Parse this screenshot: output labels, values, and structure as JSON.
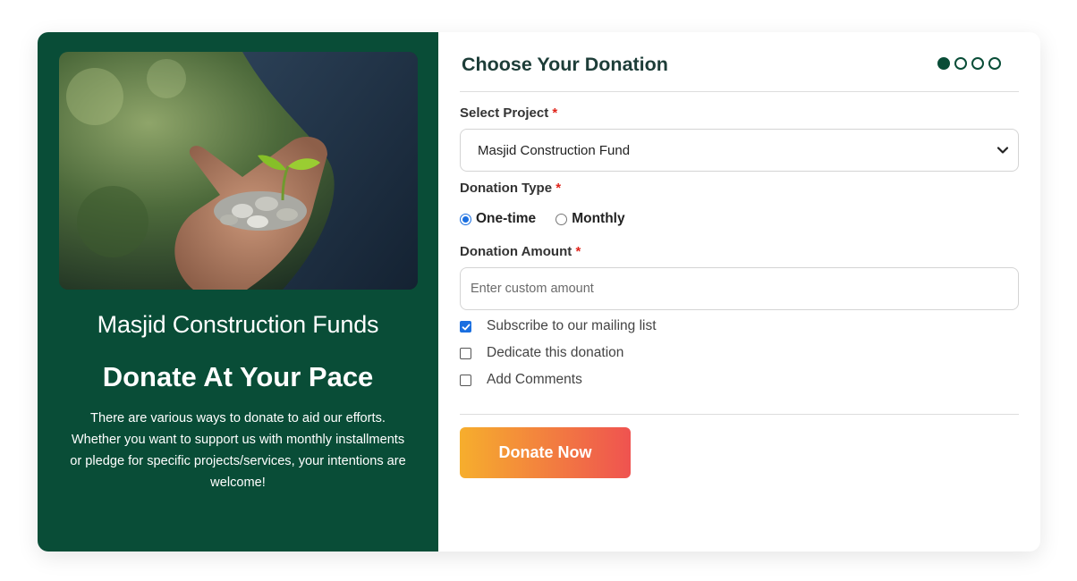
{
  "left_panel": {
    "title": "Masjid Construction Funds",
    "heading": "Donate At Your Pace",
    "description": "There are various ways to donate to aid our efforts. Whether you want to support us with monthly installments or pledge for specific projects/services, your intentions are welcome!"
  },
  "form": {
    "title": "Choose Your Donation",
    "steps": {
      "current": 1,
      "total": 4
    },
    "required_marker": "*",
    "project": {
      "label": "Select Project",
      "selected": "Masjid Construction Fund"
    },
    "donation_type": {
      "label": "Donation Type",
      "options": [
        {
          "label": "One-time",
          "selected": true
        },
        {
          "label": "Monthly",
          "selected": false
        }
      ]
    },
    "amount": {
      "label": "Donation Amount",
      "placeholder": "Enter custom amount",
      "value": ""
    },
    "checkboxes": [
      {
        "label": "Subscribe to our mailing list",
        "checked": true
      },
      {
        "label": "Dedicate this donation",
        "checked": false
      },
      {
        "label": "Add Comments",
        "checked": false
      }
    ],
    "submit_label": "Donate Now"
  },
  "colors": {
    "panel_green": "#094d37",
    "button_gradient_start": "#f6ae2d",
    "button_gradient_end": "#ef5350",
    "required": "#e0241b",
    "checkbox_accent": "#1a6fe0"
  }
}
